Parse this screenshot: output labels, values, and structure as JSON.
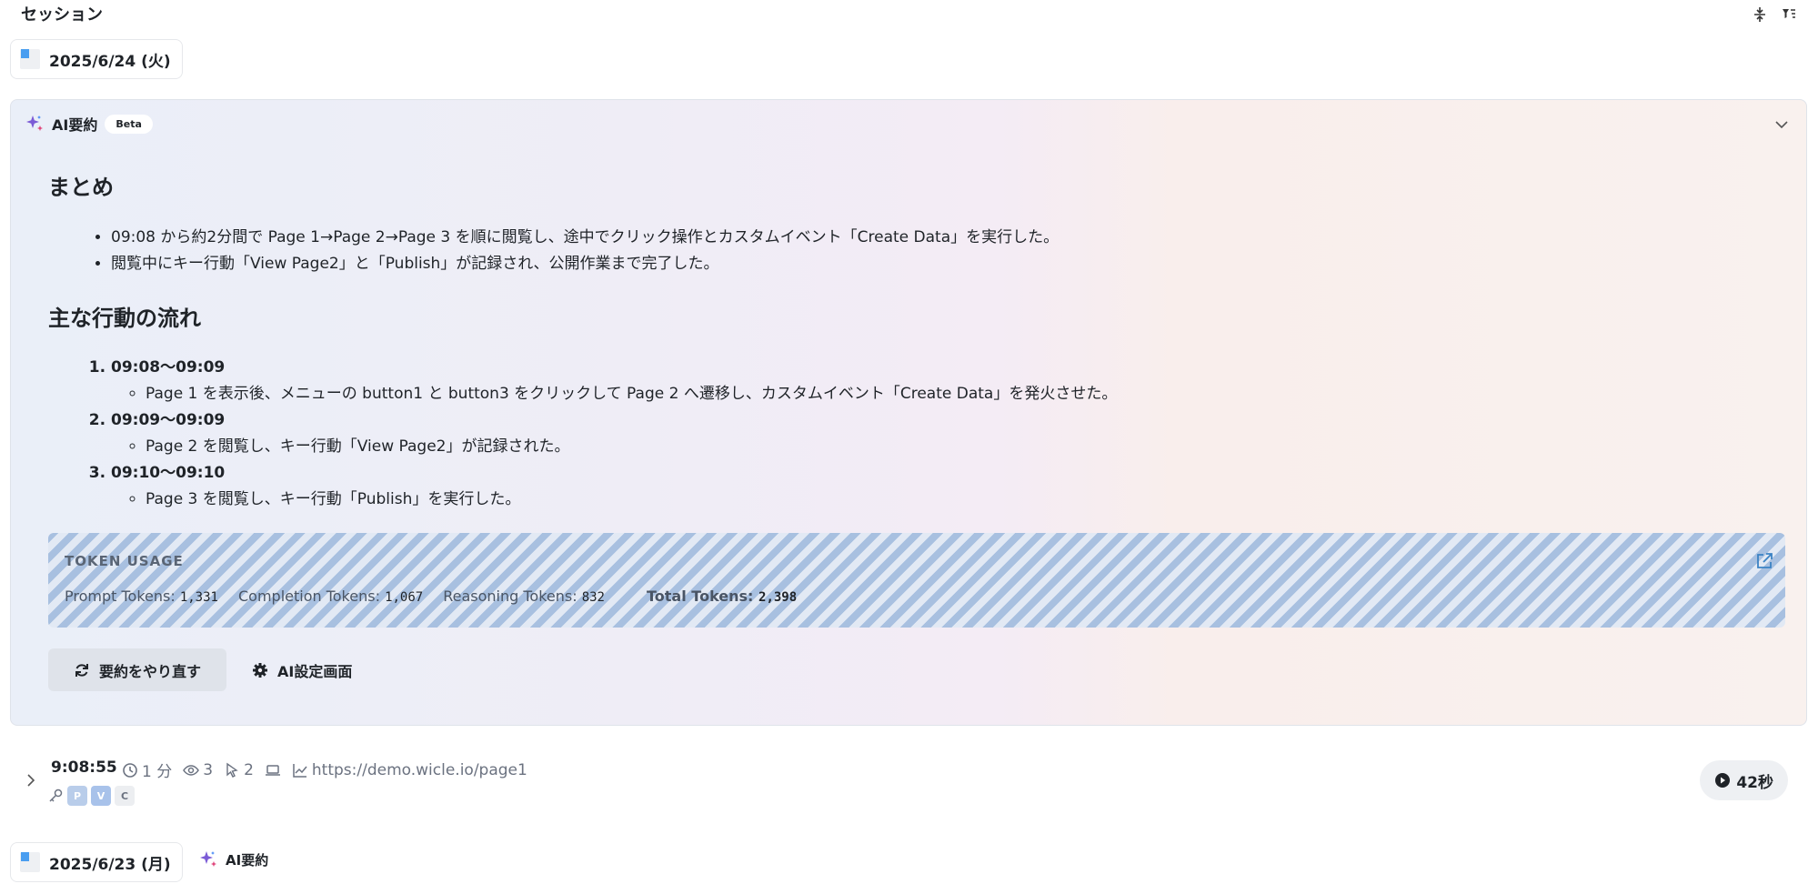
{
  "header": {
    "title": "セッション"
  },
  "dates": [
    {
      "label": "2025/6/24 (火)"
    },
    {
      "label": "2025/6/23 (月)"
    }
  ],
  "ai_summary": {
    "title": "AI要約",
    "beta": "Beta",
    "summary_heading": "まとめ",
    "summary_items": [
      "09:08 から約2分間で Page 1→Page 2→Page 3 を順に閲覧し、途中でクリック操作とカスタムイベント「Create Data」を実行した。",
      "閲覧中にキー行動「View Page2」と「Publish」が記録され、公開作業まで完了した。"
    ],
    "flow_heading": "主な行動の流れ",
    "flow": [
      {
        "time": "09:08〜09:09",
        "detail": "Page 1 を表示後、メニューの button1 と button3 をクリックして Page 2 へ遷移し、カスタムイベント「Create Data」を発火させた。"
      },
      {
        "time": "09:09〜09:09",
        "detail": "Page 2 を閲覧し、キー行動「View Page2」が記録された。"
      },
      {
        "time": "09:10〜09:10",
        "detail": "Page 3 を閲覧し、キー行動「Publish」を実行した。"
      }
    ],
    "tokens": {
      "label": "TOKEN USAGE",
      "prompt_label": "Prompt Tokens:",
      "prompt": "1,331",
      "completion_label": "Completion Tokens:",
      "completion": "1,067",
      "reasoning_label": "Reasoning Tokens:",
      "reasoning": "832",
      "total_label": "Total Tokens:",
      "total": "2,398"
    },
    "redo_button": "要約をやり直す",
    "settings_button": "AI設定画面"
  },
  "session": {
    "time": "9:08:55",
    "duration": "1 分",
    "views": "3",
    "clicks": "2",
    "url": "https://demo.wicle.io/page1",
    "badges": [
      "P",
      "V",
      "C"
    ],
    "play_label": "42秒"
  },
  "ai_link": "AI要約",
  "colors": {
    "accent": "#4a9ef0",
    "stripe": "#a8c0e0"
  }
}
